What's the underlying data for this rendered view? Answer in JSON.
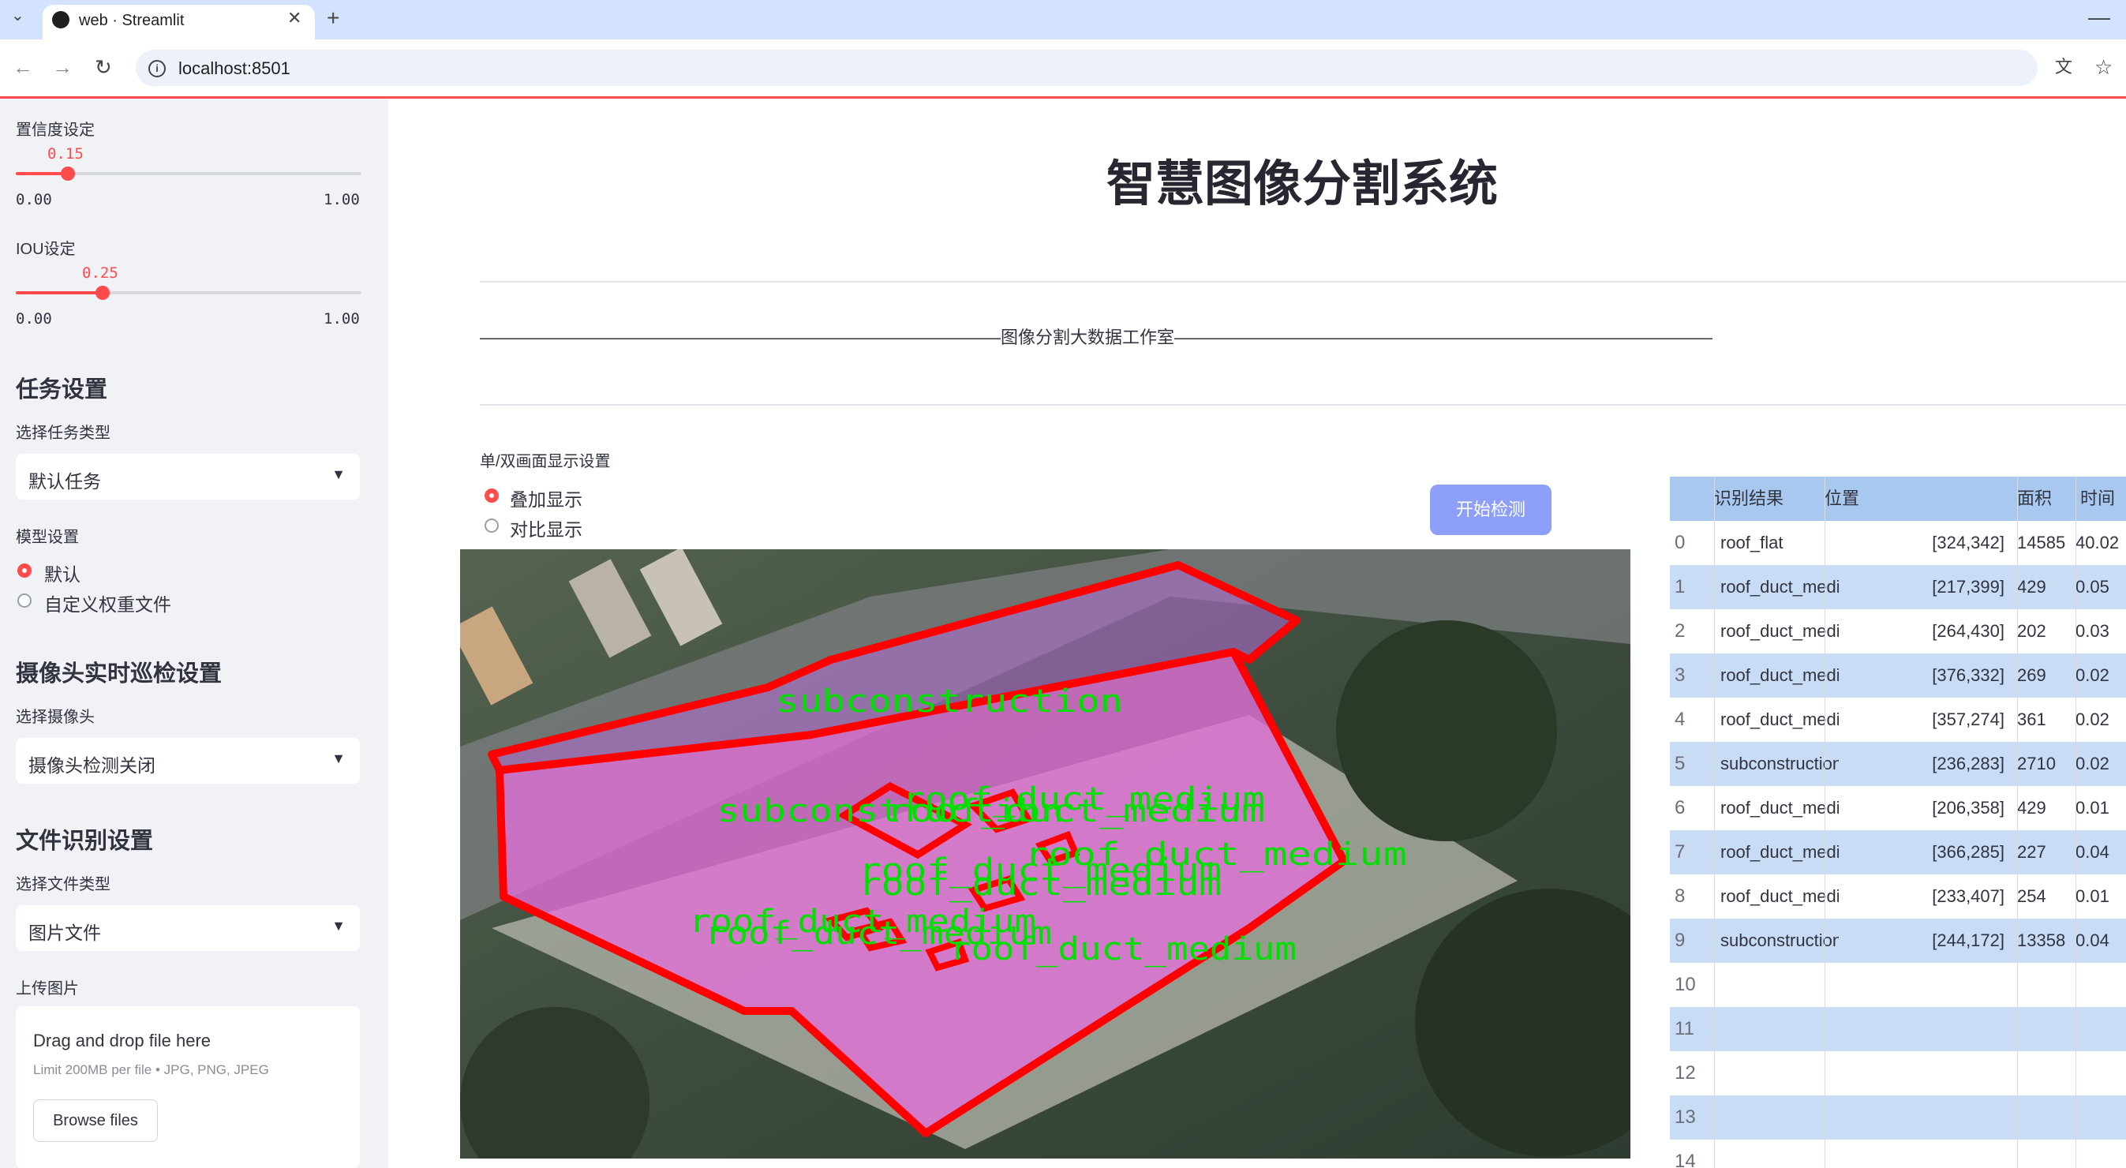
{
  "browser": {
    "tab_title": "web · Streamlit",
    "url": "localhost:8501"
  },
  "sidebar": {
    "confidence_label": "置信度设定",
    "confidence_value": "0.15",
    "confidence_fraction": 0.15,
    "iou_label": "IOU设定",
    "iou_value": "0.25",
    "iou_fraction": 0.25,
    "slider_min": "0.00",
    "slider_max": "1.00",
    "task_heading": "任务设置",
    "task_type_label": "选择任务类型",
    "task_type_value": "默认任务",
    "model_label": "模型设置",
    "model_options": [
      "默认",
      "自定义权重文件"
    ],
    "model_selected": "默认",
    "camera_heading": "摄像头实时巡检设置",
    "camera_label": "选择摄像头",
    "camera_value": "摄像头检测关闭",
    "file_heading": "文件识别设置",
    "file_type_label": "选择文件类型",
    "file_type_value": "图片文件",
    "upload_label": "上传图片",
    "upload_drop_text": "Drag and drop file here",
    "upload_limit_text": "Limit 200MB per file • JPG, PNG, JPEG",
    "browse_label": "Browse files"
  },
  "main": {
    "title": "智慧图像分割系统",
    "banner": "——————————————————————————————图像分割大数据工作室———————————————————————————————",
    "display_label": "单/双画面显示设置",
    "display_options": [
      "叠加显示",
      "对比显示"
    ],
    "display_selected": "叠加显示",
    "start_button": "开始检测"
  },
  "detection_labels": {
    "subconstruction": "subconstruction",
    "roof_duct_medium": "roof_duct_medium"
  },
  "colors": {
    "accent": "#ff4b4b",
    "button": "#8d9ff9",
    "mask": "#e36fd8",
    "outline": "#ff0000",
    "label_text": "#00e000",
    "table_stripe": "#c8dcf6"
  },
  "results_table": {
    "columns": [
      "识别结果",
      "位置",
      "面积",
      "时间"
    ],
    "rows": [
      {
        "index": "0",
        "label": "roof_flat",
        "position": "[324,342]",
        "area": "14585",
        "time": "40.02"
      },
      {
        "index": "1",
        "label": "roof_duct_medium",
        "position": "[217,399]",
        "area": "429",
        "time": "0.05"
      },
      {
        "index": "2",
        "label": "roof_duct_medium",
        "position": "[264,430]",
        "area": "202",
        "time": "0.03"
      },
      {
        "index": "3",
        "label": "roof_duct_medium",
        "position": "[376,332]",
        "area": "269",
        "time": "0.02"
      },
      {
        "index": "4",
        "label": "roof_duct_medium",
        "position": "[357,274]",
        "area": "361",
        "time": "0.02"
      },
      {
        "index": "5",
        "label": "subconstruction",
        "position": "[236,283]",
        "area": "2710",
        "time": "0.02"
      },
      {
        "index": "6",
        "label": "roof_duct_medium",
        "position": "[206,358]",
        "area": "429",
        "time": "0.01"
      },
      {
        "index": "7",
        "label": "roof_duct_medium",
        "position": "[366,285]",
        "area": "227",
        "time": "0.04"
      },
      {
        "index": "8",
        "label": "roof_duct_medium",
        "position": "[233,407]",
        "area": "254",
        "time": "0.01"
      },
      {
        "index": "9",
        "label": "subconstruction",
        "position": "[244,172]",
        "area": "13358",
        "time": "0.04"
      },
      {
        "index": "10",
        "label": "",
        "position": "",
        "area": "",
        "time": ""
      },
      {
        "index": "11",
        "label": "",
        "position": "",
        "area": "",
        "time": ""
      },
      {
        "index": "12",
        "label": "",
        "position": "",
        "area": "",
        "time": ""
      },
      {
        "index": "13",
        "label": "",
        "position": "",
        "area": "",
        "time": ""
      },
      {
        "index": "14",
        "label": "",
        "position": "",
        "area": "",
        "time": ""
      }
    ]
  }
}
